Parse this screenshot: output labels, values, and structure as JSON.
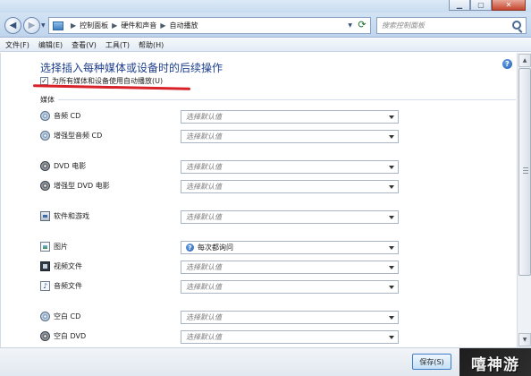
{
  "window": {
    "minimize_glyph": "▁",
    "maximize_glyph": "▢",
    "close_glyph": "✕"
  },
  "nav": {
    "back_glyph": "◀",
    "forward_glyph": "▶",
    "dropdown_glyph": "▼",
    "refresh_glyph": "⟳"
  },
  "address": {
    "crumbs": [
      "控制面板",
      "硬件和声音",
      "自动播放"
    ],
    "separator": "▶",
    "dropdown_glyph": "▼"
  },
  "search": {
    "placeholder": "搜索控制面板"
  },
  "menu": {
    "items": [
      "文件(F)",
      "编辑(E)",
      "查看(V)",
      "工具(T)",
      "帮助(H)"
    ]
  },
  "content": {
    "title": "选择插入每种媒体或设备时的后续操作",
    "autoplay_label": "为所有媒体和设备使用自动播放(U)",
    "autoplay_checked": true,
    "check_glyph": "✓",
    "section_label": "媒体",
    "help_glyph": "?",
    "rows": [
      {
        "label": "音频 CD",
        "icon": "cd-icon",
        "value": "选择默认值"
      },
      {
        "label": "增强型音频 CD",
        "icon": "cd-icon",
        "value": "选择默认值"
      },
      {
        "label": "DVD 电影",
        "icon": "dvd-icon",
        "value": "选择默认值"
      },
      {
        "label": "增强型 DVD 电影",
        "icon": "dvd-icon",
        "value": "选择默认值"
      },
      {
        "label": "软件和游戏",
        "icon": "software-icon",
        "value": "选择默认值"
      },
      {
        "label": "图片",
        "icon": "picture-icon",
        "value": "每次都询问"
      },
      {
        "label": "视频文件",
        "icon": "video-icon",
        "value": "选择默认值"
      },
      {
        "label": "音频文件",
        "icon": "audio-file-icon",
        "value": "选择默认值"
      },
      {
        "label": "空白 CD",
        "icon": "cd-icon",
        "value": "选择默认值"
      },
      {
        "label": "空白 DVD",
        "icon": "dvd-icon",
        "value": "选择默认值"
      }
    ],
    "audio_glyph": "♪"
  },
  "scrollbar": {
    "up_glyph": "▲",
    "down_glyph": "▼"
  },
  "footer": {
    "save_label": "保存(S)",
    "watermark": "嘻神游"
  },
  "colors": {
    "title": "#1e3f8c",
    "annotation_underline": "#d8222a",
    "chrome": "#c9dcf0"
  }
}
